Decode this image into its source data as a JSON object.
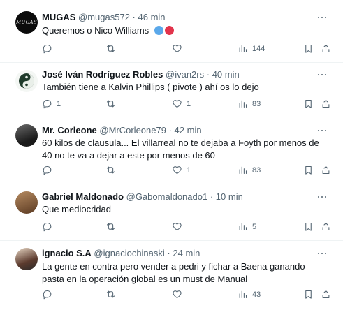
{
  "tweets": [
    {
      "name": "MUGAS",
      "handle": "@mugas572",
      "time": "46 min",
      "text": "Queremos o Nico Williams",
      "emoji_colors": [
        "#5aa8ea",
        "#e2334b"
      ],
      "avatar_text": "MUGAS",
      "replies": "",
      "likes": "",
      "views": "144"
    },
    {
      "name": "José Iván Rodríguez Robles",
      "handle": "@ivan2rs",
      "time": "40 min",
      "text": "También tiene a Kalvin Phillips ( pivote ) ahí os lo dejo",
      "replies": "1",
      "likes": "1",
      "views": "83"
    },
    {
      "name": "Mr. Corleone",
      "handle": "@MrCorleone79",
      "time": "42 min",
      "text": "60 kilos de clausula... El villarreal no te dejaba a Foyth por menos de 40 no te va a dejar a este por menos de 60",
      "replies": "",
      "likes": "1",
      "views": "83"
    },
    {
      "name": "Gabriel Maldonado",
      "handle": "@Gabomaldonado1",
      "time": "10 min",
      "text": "Que mediocridad",
      "replies": "",
      "likes": "",
      "views": "5"
    },
    {
      "name": "ignacio S.A",
      "handle": "@ignaciochinaski",
      "time": "24 min",
      "text": "La gente en contra pero vender a pedri y fichar a Baena ganando pasta en la operación global es un must de Manual",
      "replies": "",
      "likes": "",
      "views": "43"
    }
  ],
  "separator": "·"
}
